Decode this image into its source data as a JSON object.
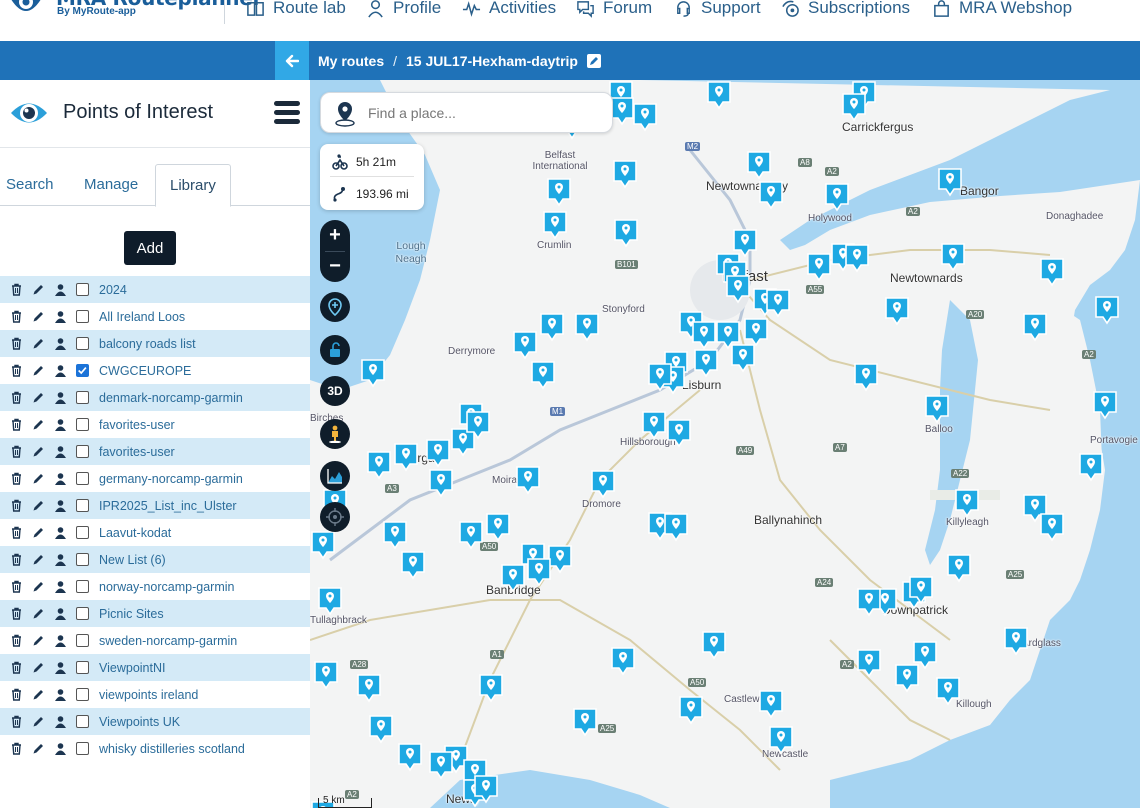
{
  "brand": {
    "name": "MRA Routeplanner",
    "sub": "By MyRoute-app"
  },
  "nav": {
    "items": [
      {
        "label": "Route lab",
        "icon": "book-icon"
      },
      {
        "label": "Profile",
        "icon": "user-icon"
      },
      {
        "label": "Activities",
        "icon": "pulse-icon"
      },
      {
        "label": "Forum",
        "icon": "chat-icon"
      },
      {
        "label": "Support",
        "icon": "headset-icon"
      },
      {
        "label": "Subscriptions",
        "icon": "subscription-icon"
      },
      {
        "label": "MRA Webshop",
        "icon": "shopping-bag-icon"
      }
    ]
  },
  "breadcrumb": {
    "root": "My routes",
    "separator": "/",
    "current": "15 JUL17-Hexham-daytrip"
  },
  "sidebar": {
    "title": "Points of Interest",
    "tabs": {
      "search": "Search",
      "manage": "Manage",
      "library": "Library"
    },
    "add_label": "Add",
    "lists": [
      {
        "name": "2024",
        "checked": false
      },
      {
        "name": "All Ireland Loos",
        "checked": false
      },
      {
        "name": "balcony roads list",
        "checked": false
      },
      {
        "name": "CWGCEUROPE",
        "checked": true
      },
      {
        "name": "denmark-norcamp-garmin",
        "checked": false
      },
      {
        "name": "favorites-user",
        "checked": false
      },
      {
        "name": "favorites-user",
        "checked": false
      },
      {
        "name": "germany-norcamp-garmin",
        "checked": false
      },
      {
        "name": "IPR2025_List_inc_Ulster",
        "checked": false
      },
      {
        "name": "Laavut-kodat",
        "checked": false
      },
      {
        "name": "New List (6)",
        "checked": false
      },
      {
        "name": "norway-norcamp-garmin",
        "checked": false
      },
      {
        "name": "Picnic Sites",
        "checked": false
      },
      {
        "name": "sweden-norcamp-garmin",
        "checked": false
      },
      {
        "name": "ViewpointNI",
        "checked": false
      },
      {
        "name": "viewpoints ireland",
        "checked": false
      },
      {
        "name": "Viewpoints UK",
        "checked": false
      },
      {
        "name": "whisky distilleries scotland",
        "checked": false
      }
    ]
  },
  "map": {
    "search_placeholder": "Find a place...",
    "duration": "5h 21m",
    "distance": "193.96 mi",
    "zoom_in": "+",
    "zoom_out": "−",
    "tool_3d": "3D",
    "scale": "5 km",
    "places": {
      "carrickfergus": "Carrickfergus",
      "newtownabbey": "Newtownabbey",
      "bangor": "Bangor",
      "holywood": "Holywood",
      "donaghadee": "Donaghadee",
      "belfast_intl": "Belfast International",
      "crumlin": "Crumlin",
      "lough_neagh": "Lough Neagh",
      "belfast": "Belfast",
      "newtownards": "Newtownards",
      "stonyford": "Stonyford",
      "derrymore": "Derrymore",
      "lisburn": "Lisburn",
      "balloo": "Balloo",
      "portavogie": "Portavogie",
      "birches": "Birches",
      "hillsborough": "Hillsborough",
      "lurgan": "Lurgan",
      "moira": "Moira",
      "dromore": "Dromore",
      "ballynahinch": "Ballynahinch",
      "killyleagh": "Killyleagh",
      "banbridge": "Banbridge",
      "tullaghbrack": "Tullaghbrack",
      "downpatrick": "Downpatrick",
      "ardglass": "Ardglass",
      "castlewellan": "Castlewellan",
      "killough": "Killough",
      "newcastle": "Newcastle",
      "newry": "Newry"
    },
    "roads": {
      "m2": "M2",
      "a8": "A8",
      "a2_top": "A2",
      "a2_east": "A2",
      "a55": "A55",
      "b101": "B101",
      "a20": "A20",
      "a2_pen": "A2",
      "m1": "M1",
      "a49": "A49",
      "a7": "A7",
      "a22": "A22",
      "a3": "A3",
      "a50": "A50",
      "a24": "A24",
      "a25": "A25",
      "a28": "A28",
      "a1": "A1",
      "a50_s": "A50",
      "a2_s": "A2",
      "a25_s": "A25",
      "a2_se": "A2"
    }
  }
}
